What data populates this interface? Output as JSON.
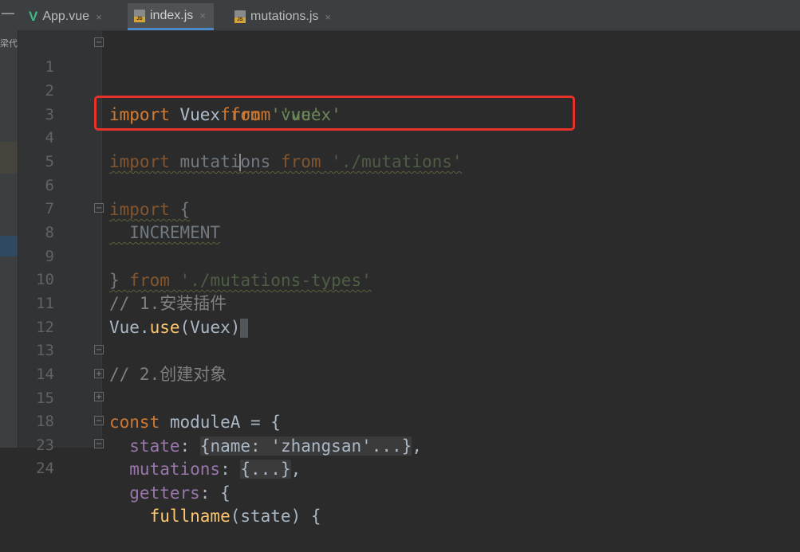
{
  "tabs": [
    {
      "label": "App.vue",
      "icon": "vue-icon",
      "active": false
    },
    {
      "label": "index.js",
      "icon": "js-file-icon",
      "active": true
    },
    {
      "label": "mutations.js",
      "icon": "js-file-icon",
      "active": false
    }
  ],
  "tab_close_glyph": "×",
  "left_tool_text": "梁代",
  "collapse_glyph": "—",
  "lines": [
    {
      "num": "1",
      "p1": "import",
      "p2": " Vue ",
      "p3": "from",
      "p4": " 'vue'"
    },
    {
      "num": "2",
      "p1": "import",
      "p2": " Vuex ",
      "p3": "from",
      "p4": " 'vuex'"
    },
    {
      "num": "3"
    },
    {
      "num": "4",
      "p1": "import",
      "p2a": " mutati",
      "p2b": "ons ",
      "p3": "from",
      "p4": " './mutations'"
    },
    {
      "num": "5"
    },
    {
      "num": "6",
      "p1": "import",
      "p2": " {"
    },
    {
      "num": "7",
      "p2": "  INCREMENT"
    },
    {
      "num": "8",
      "p2": "} ",
      "p3": "from",
      "p4": " './mutations-types'"
    },
    {
      "num": "9"
    },
    {
      "num": "10",
      "comment": "// 1.安装插件"
    },
    {
      "num": "11",
      "p2": "Vue.",
      "fn": "use",
      "p5": "(Vuex)"
    },
    {
      "num": "12"
    },
    {
      "num": "13",
      "comment": "// 2.创建对象"
    },
    {
      "num": "14",
      "p1": "const",
      "p2": " moduleA = {"
    },
    {
      "num": "15",
      "prop": "  state",
      "p2": ": ",
      "folded": "{name: 'zhangsan'...}",
      "p5": ","
    },
    {
      "num": "18",
      "prop": "  mutations",
      "p2": ": ",
      "folded": "{...}",
      "p5": ","
    },
    {
      "num": "23",
      "prop": "  getters",
      "p2": ": {"
    },
    {
      "num": "24",
      "fn": "    fullname",
      "p5": "(state) {"
    }
  ],
  "accent": {
    "highlight_border": "#e8312a",
    "keyword": "#cc7832",
    "string": "#6a8759",
    "comment": "#808080",
    "active_tab_underline": "#4a88c7"
  }
}
